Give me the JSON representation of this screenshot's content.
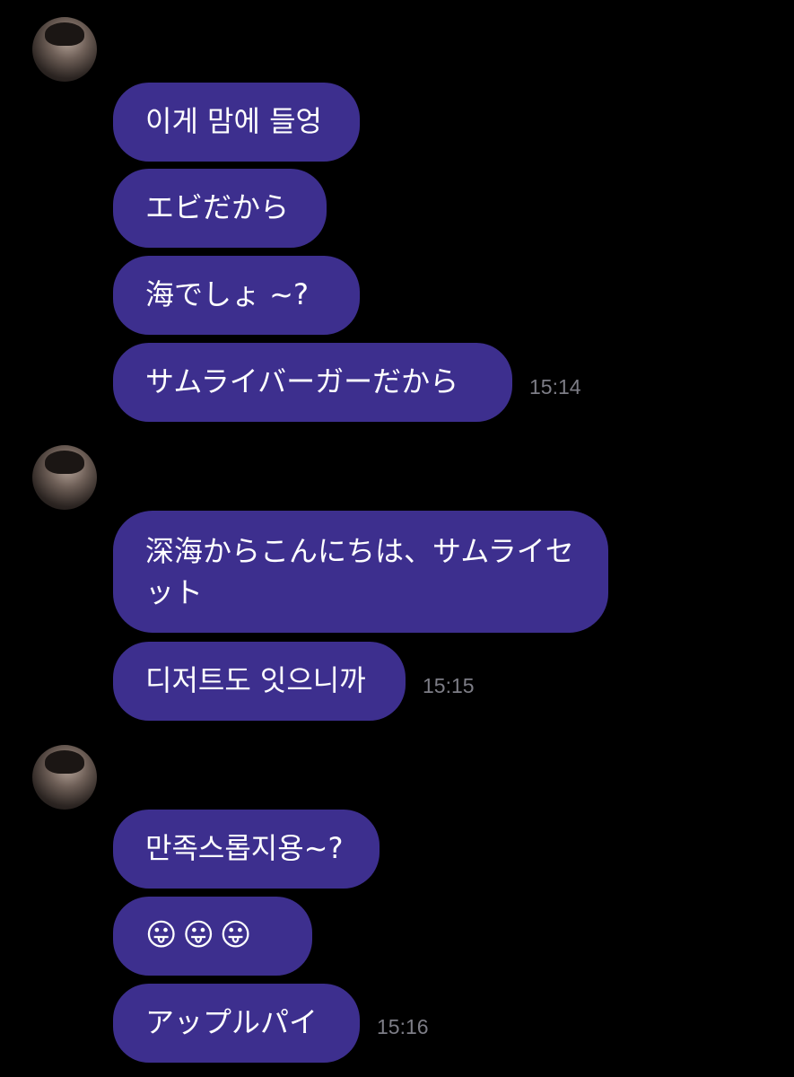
{
  "sender": {
    "name_badge": "🐱"
  },
  "groups": [
    {
      "messages": [
        "이게 맘에 들엉",
        "エビだから",
        "海でしょ ~?",
        "サムライバーガーだから"
      ],
      "time": "15:14"
    },
    {
      "messages": [
        "深海からこんにちは、サムライセット",
        "디저트도 잇으니까"
      ],
      "time": "15:15"
    },
    {
      "messages": [
        "만족스롭지용~?",
        "😛😛😛",
        "アップルパイ"
      ],
      "time": "15:16"
    }
  ],
  "colors": {
    "bubble": "#3d2f8e",
    "background": "#000000",
    "timestamp": "#7d7d86"
  }
}
